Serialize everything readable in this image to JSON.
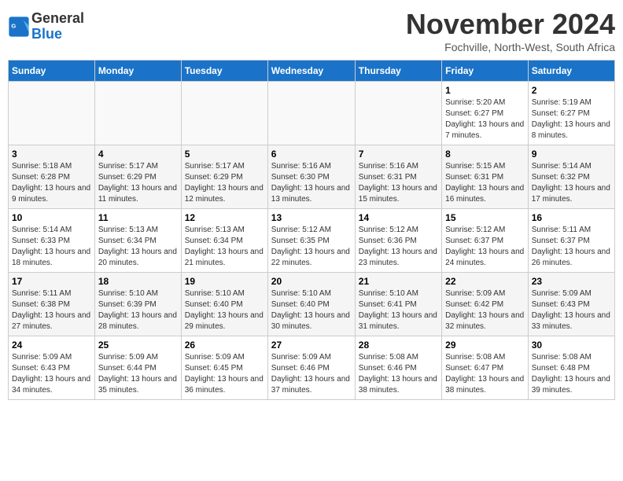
{
  "logo": {
    "line1": "General",
    "line2": "Blue"
  },
  "title": "November 2024",
  "subtitle": "Fochville, North-West, South Africa",
  "days_of_week": [
    "Sunday",
    "Monday",
    "Tuesday",
    "Wednesday",
    "Thursday",
    "Friday",
    "Saturday"
  ],
  "weeks": [
    [
      {
        "day": "",
        "info": ""
      },
      {
        "day": "",
        "info": ""
      },
      {
        "day": "",
        "info": ""
      },
      {
        "day": "",
        "info": ""
      },
      {
        "day": "",
        "info": ""
      },
      {
        "day": "1",
        "info": "Sunrise: 5:20 AM\nSunset: 6:27 PM\nDaylight: 13 hours and 7 minutes."
      },
      {
        "day": "2",
        "info": "Sunrise: 5:19 AM\nSunset: 6:27 PM\nDaylight: 13 hours and 8 minutes."
      }
    ],
    [
      {
        "day": "3",
        "info": "Sunrise: 5:18 AM\nSunset: 6:28 PM\nDaylight: 13 hours and 9 minutes."
      },
      {
        "day": "4",
        "info": "Sunrise: 5:17 AM\nSunset: 6:29 PM\nDaylight: 13 hours and 11 minutes."
      },
      {
        "day": "5",
        "info": "Sunrise: 5:17 AM\nSunset: 6:29 PM\nDaylight: 13 hours and 12 minutes."
      },
      {
        "day": "6",
        "info": "Sunrise: 5:16 AM\nSunset: 6:30 PM\nDaylight: 13 hours and 13 minutes."
      },
      {
        "day": "7",
        "info": "Sunrise: 5:16 AM\nSunset: 6:31 PM\nDaylight: 13 hours and 15 minutes."
      },
      {
        "day": "8",
        "info": "Sunrise: 5:15 AM\nSunset: 6:31 PM\nDaylight: 13 hours and 16 minutes."
      },
      {
        "day": "9",
        "info": "Sunrise: 5:14 AM\nSunset: 6:32 PM\nDaylight: 13 hours and 17 minutes."
      }
    ],
    [
      {
        "day": "10",
        "info": "Sunrise: 5:14 AM\nSunset: 6:33 PM\nDaylight: 13 hours and 18 minutes."
      },
      {
        "day": "11",
        "info": "Sunrise: 5:13 AM\nSunset: 6:34 PM\nDaylight: 13 hours and 20 minutes."
      },
      {
        "day": "12",
        "info": "Sunrise: 5:13 AM\nSunset: 6:34 PM\nDaylight: 13 hours and 21 minutes."
      },
      {
        "day": "13",
        "info": "Sunrise: 5:12 AM\nSunset: 6:35 PM\nDaylight: 13 hours and 22 minutes."
      },
      {
        "day": "14",
        "info": "Sunrise: 5:12 AM\nSunset: 6:36 PM\nDaylight: 13 hours and 23 minutes."
      },
      {
        "day": "15",
        "info": "Sunrise: 5:12 AM\nSunset: 6:37 PM\nDaylight: 13 hours and 24 minutes."
      },
      {
        "day": "16",
        "info": "Sunrise: 5:11 AM\nSunset: 6:37 PM\nDaylight: 13 hours and 26 minutes."
      }
    ],
    [
      {
        "day": "17",
        "info": "Sunrise: 5:11 AM\nSunset: 6:38 PM\nDaylight: 13 hours and 27 minutes."
      },
      {
        "day": "18",
        "info": "Sunrise: 5:10 AM\nSunset: 6:39 PM\nDaylight: 13 hours and 28 minutes."
      },
      {
        "day": "19",
        "info": "Sunrise: 5:10 AM\nSunset: 6:40 PM\nDaylight: 13 hours and 29 minutes."
      },
      {
        "day": "20",
        "info": "Sunrise: 5:10 AM\nSunset: 6:40 PM\nDaylight: 13 hours and 30 minutes."
      },
      {
        "day": "21",
        "info": "Sunrise: 5:10 AM\nSunset: 6:41 PM\nDaylight: 13 hours and 31 minutes."
      },
      {
        "day": "22",
        "info": "Sunrise: 5:09 AM\nSunset: 6:42 PM\nDaylight: 13 hours and 32 minutes."
      },
      {
        "day": "23",
        "info": "Sunrise: 5:09 AM\nSunset: 6:43 PM\nDaylight: 13 hours and 33 minutes."
      }
    ],
    [
      {
        "day": "24",
        "info": "Sunrise: 5:09 AM\nSunset: 6:43 PM\nDaylight: 13 hours and 34 minutes."
      },
      {
        "day": "25",
        "info": "Sunrise: 5:09 AM\nSunset: 6:44 PM\nDaylight: 13 hours and 35 minutes."
      },
      {
        "day": "26",
        "info": "Sunrise: 5:09 AM\nSunset: 6:45 PM\nDaylight: 13 hours and 36 minutes."
      },
      {
        "day": "27",
        "info": "Sunrise: 5:09 AM\nSunset: 6:46 PM\nDaylight: 13 hours and 37 minutes."
      },
      {
        "day": "28",
        "info": "Sunrise: 5:08 AM\nSunset: 6:46 PM\nDaylight: 13 hours and 38 minutes."
      },
      {
        "day": "29",
        "info": "Sunrise: 5:08 AM\nSunset: 6:47 PM\nDaylight: 13 hours and 38 minutes."
      },
      {
        "day": "30",
        "info": "Sunrise: 5:08 AM\nSunset: 6:48 PM\nDaylight: 13 hours and 39 minutes."
      }
    ]
  ]
}
